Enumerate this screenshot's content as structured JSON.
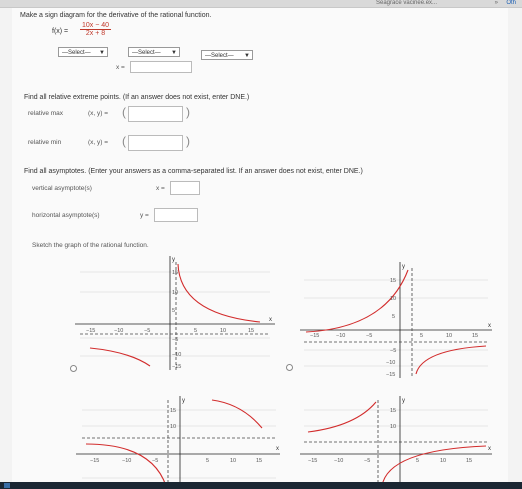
{
  "browser": {
    "tab_label": "Seagrace vacinee.ex...",
    "more_label": "»",
    "edge_label": "Oth"
  },
  "question": {
    "prompt": "Make a sign diagram for the derivative of the rational function.",
    "function_name": "f(x) =",
    "numerator": "10x − 40",
    "denominator": "2x + 8",
    "selects": [
      "—Select—",
      "—Select—",
      "—Select—"
    ],
    "x_label": "x ="
  },
  "extrema": {
    "prompt": "Find all relative extreme points. (If an answer does not exist, enter DNE.)",
    "max_label": "relative max",
    "min_label": "relative min",
    "xy_label": "(x, y) ="
  },
  "asymptotes": {
    "prompt": "Find all asymptotes. (Enter your answers as a comma-separated list. If an answer does not exist, enter DNE.)",
    "vertical_label": "vertical asymptote(s)",
    "vertical_var": "x =",
    "horizontal_label": "horizontal asymptote(s)",
    "horizontal_var": "y ="
  },
  "graph_section": {
    "prompt": "Sketch the graph of the rational function.",
    "x_axis_label": "x",
    "y_axis_label": "y",
    "x_ticks": [
      "−15",
      "−10",
      "−5",
      "5",
      "10",
      "15"
    ],
    "y_ticks": [
      "15",
      "10",
      "5",
      "−5",
      "−10",
      "−15"
    ]
  },
  "colors": {
    "curve": "#d22c2c",
    "asymptote": "#444444",
    "axis": "#222222"
  }
}
